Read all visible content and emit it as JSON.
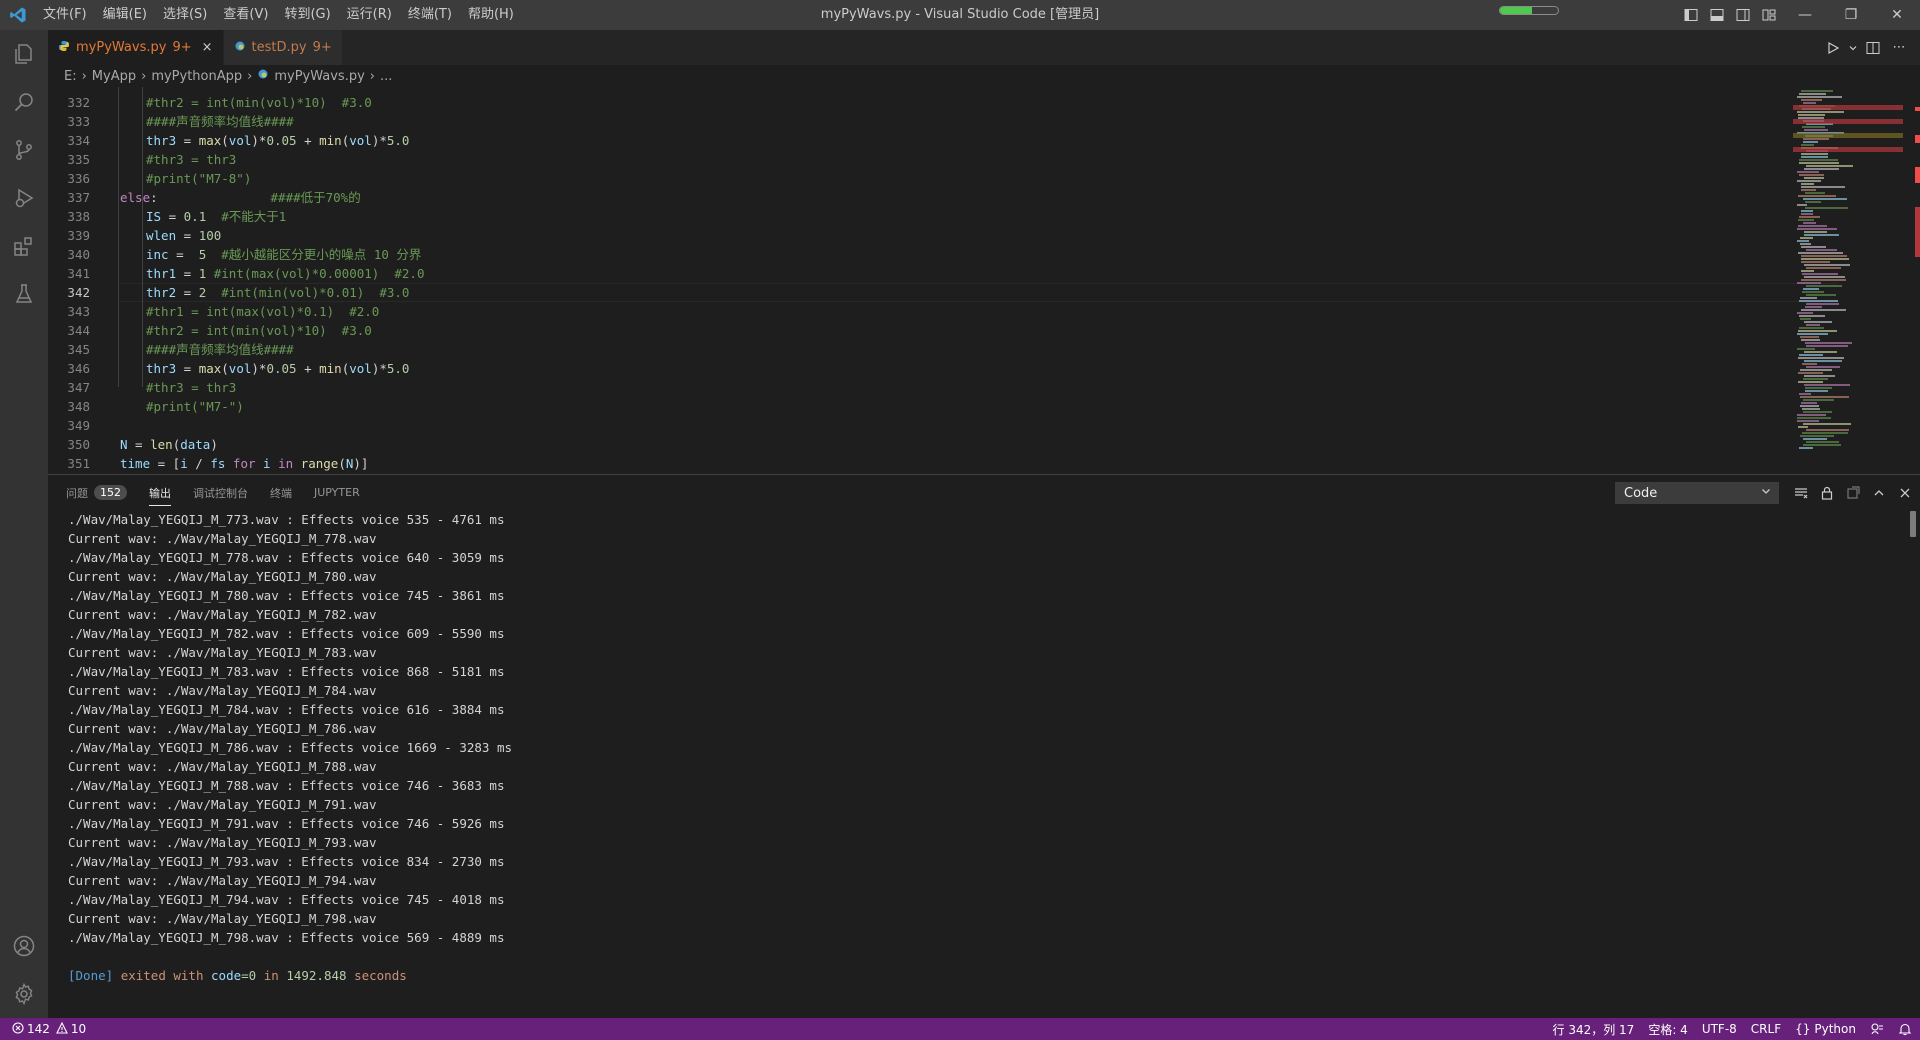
{
  "window": {
    "title": "myPyWavs.py - Visual Studio Code [管理员]",
    "progress_fraction": 0.55
  },
  "menu": [
    "文件(F)",
    "编辑(E)",
    "选择(S)",
    "查看(V)",
    "转到(G)",
    "运行(R)",
    "终端(T)",
    "帮助(H)"
  ],
  "tabs": [
    {
      "label": "myPyWavs.py",
      "badge": "9+",
      "close": "×"
    },
    {
      "label": "testD.py",
      "badge": "9+"
    }
  ],
  "breadcrumb": [
    "E:",
    "MyApp",
    "myPythonApp",
    "myPyWavs.py",
    "..."
  ],
  "editor": {
    "line_numbers": [
      "332",
      "333",
      "334",
      "335",
      "336",
      "337",
      "338",
      "339",
      "340",
      "341",
      "342",
      "343",
      "344",
      "345",
      "346",
      "347",
      "348",
      "349",
      "350",
      "351"
    ],
    "current_line": "342",
    "lines": [
      "#thr2 = int(min(vol)*10)  #3.0",
      "####声音频率均值线####",
      "thr3 = max(vol)*0.05 + min(vol)*5.0",
      "#thr3 = thr3",
      "#print(\"M7-8\")",
      "else:",
      "IS = 0.1  #不能大于1",
      "wlen = 100",
      "inc =  5  #越小越能区分更小的噪点 10 分界",
      "thr1 = 1 #int(max(vol)*0.00001)  #2.0",
      "thr2 = 2  #int(min(vol)*0.01)  #3.0",
      "#thr1 = int(max(vol)*0.1)  #2.0",
      "#thr2 = int(min(vol)*10)  #3.0",
      "####声音频率均值线####",
      "thr3 = max(vol)*0.05 + min(vol)*5.0",
      "#thr3 = thr3",
      "#print(\"M7-\")",
      "",
      "N = len(data)",
      "time = [i / fs for i in range(N)]"
    ],
    "else_comment": "####低于70%的"
  },
  "panel": {
    "tabs": [
      "问题",
      "输出",
      "调试控制台",
      "终端",
      "JUPYTER"
    ],
    "problems_count": "152",
    "channel": "Code",
    "output_lines": [
      "./Wav/Malay_YEGQIJ_M_773.wav : Effects voice 535 - 4761 ms",
      "Current wav: ./Wav/Malay_YEGQIJ_M_778.wav",
      "./Wav/Malay_YEGQIJ_M_778.wav : Effects voice 640 - 3059 ms",
      "Current wav: ./Wav/Malay_YEGQIJ_M_780.wav",
      "./Wav/Malay_YEGQIJ_M_780.wav : Effects voice 745 - 3861 ms",
      "Current wav: ./Wav/Malay_YEGQIJ_M_782.wav",
      "./Wav/Malay_YEGQIJ_M_782.wav : Effects voice 609 - 5590 ms",
      "Current wav: ./Wav/Malay_YEGQIJ_M_783.wav",
      "./Wav/Malay_YEGQIJ_M_783.wav : Effects voice 868 - 5181 ms",
      "Current wav: ./Wav/Malay_YEGQIJ_M_784.wav",
      "./Wav/Malay_YEGQIJ_M_784.wav : Effects voice 616 - 3884 ms",
      "Current wav: ./Wav/Malay_YEGQIJ_M_786.wav",
      "./Wav/Malay_YEGQIJ_M_786.wav : Effects voice 1669 - 3283 ms",
      "Current wav: ./Wav/Malay_YEGQIJ_M_788.wav",
      "./Wav/Malay_YEGQIJ_M_788.wav : Effects voice 746 - 3683 ms",
      "Current wav: ./Wav/Malay_YEGQIJ_M_791.wav",
      "./Wav/Malay_YEGQIJ_M_791.wav : Effects voice 746 - 5926 ms",
      "Current wav: ./Wav/Malay_YEGQIJ_M_793.wav",
      "./Wav/Malay_YEGQIJ_M_793.wav : Effects voice 834 - 2730 ms",
      "Current wav: ./Wav/Malay_YEGQIJ_M_794.wav",
      "./Wav/Malay_YEGQIJ_M_794.wav : Effects voice 745 - 4018 ms",
      "Current wav: ./Wav/Malay_YEGQIJ_M_798.wav",
      "./Wav/Malay_YEGQIJ_M_798.wav : Effects voice 569 - 4889 ms"
    ],
    "done": {
      "tag": "[Done]",
      "text1": "exited with",
      "key": "code",
      "eq": "=0",
      "text2": "in",
      "seconds": "1492.848",
      "text3": "seconds"
    }
  },
  "status": {
    "errors": "142",
    "warnings": "10",
    "position": "行 342，列 17",
    "spaces": "空格: 4",
    "encoding": "UTF-8",
    "eol": "CRLF",
    "language": "Python"
  },
  "colors": {
    "accent": "#68217a",
    "modified_tab": "#e37933",
    "activity_bar": "#333333",
    "title_bar": "#3c3c3c"
  },
  "icons": [
    "vscode-logo-icon",
    "explorer-icon",
    "search-icon",
    "source-control-icon",
    "run-debug-icon",
    "extensions-icon",
    "testing-icon",
    "account-icon",
    "settings-gear-icon"
  ]
}
